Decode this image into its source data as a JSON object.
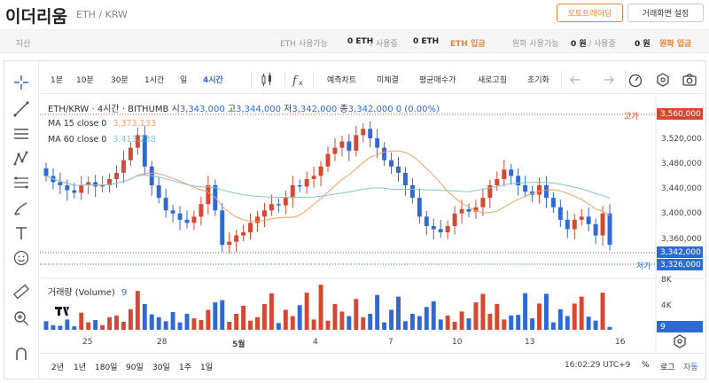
{
  "header": {
    "title": "이더리움",
    "pair": "ETH / KRW",
    "auto_trading_button": "오토트레이딩",
    "settings_button": "거래화면 설정"
  },
  "assets": {
    "label": "자산",
    "eth_available_label": "ETH 사용가능",
    "eth_available_value": "0 ETH",
    "eth_in_use_label": "/ 사용중",
    "eth_in_use_value": "0 ETH",
    "eth_deposit": "ETH 입금",
    "krw_available_label": "원화 사용가능",
    "krw_available_value": "0 원",
    "krw_in_use_label": "/ 사용중",
    "krw_in_use_value": "0 원",
    "krw_deposit": "원화 입금"
  },
  "toolbar": {
    "intervals": [
      "1분",
      "10분",
      "30분",
      "1시간",
      "일",
      "4시간"
    ],
    "active_interval": "4시간",
    "items": [
      "예측차트",
      "미체결",
      "평균매수가",
      "새로고침",
      "초기화"
    ]
  },
  "legend": {
    "symbol": "ETH/KRW · 4시간 · BITHUMB",
    "open_label": "시",
    "open_value": "3,343,000",
    "high_label": "고",
    "high_value": "3,344,000",
    "low_label": "저",
    "low_value": "3,342,000",
    "close_label": "종",
    "close_value": "3,342,000",
    "change": "0 (0.00%)",
    "ma15_label": "MA 15 close 0",
    "ma15_value": "3,373,133",
    "ma60_label": "MA 60 close 0",
    "ma60_value": "3,413,238",
    "volume_label": "거래량 (Volume)",
    "volume_value": "9"
  },
  "colors": {
    "up": "#d64832",
    "down": "#2e6ad6",
    "ma15": "#f0a060",
    "ma60": "#7fc6d6",
    "accent": "#e8833a"
  },
  "chart_data": {
    "type": "candlestick",
    "price_axis": {
      "ticks": [
        "3,520,000",
        "3,480,000",
        "3,440,000",
        "3,400,000",
        "3,360,000"
      ],
      "ylim": [
        3300000,
        3580000
      ]
    },
    "volume_axis": {
      "ticks": [
        "8K",
        "4K"
      ],
      "current": "9"
    },
    "time_labels": [
      "25",
      "28",
      "5월",
      "4",
      "7",
      "10",
      "13",
      "16"
    ],
    "high_label": "고가",
    "high_value": "3,560,000",
    "low_label": "저가",
    "low_value": "3,326,000",
    "current_price": "3,342,000",
    "close": [
      3455000,
      3445000,
      3440000,
      3432000,
      3428000,
      3440000,
      3445000,
      3438000,
      3440000,
      3450000,
      3460000,
      3480000,
      3500000,
      3520000,
      3470000,
      3440000,
      3420000,
      3400000,
      3395000,
      3385000,
      3380000,
      3390000,
      3410000,
      3440000,
      3400000,
      3345000,
      3350000,
      3360000,
      3365000,
      3380000,
      3390000,
      3400000,
      3410000,
      3408000,
      3420000,
      3440000,
      3438000,
      3450000,
      3455000,
      3470000,
      3490000,
      3500000,
      3510000,
      3495000,
      3520000,
      3530000,
      3515000,
      3500000,
      3480000,
      3470000,
      3460000,
      3440000,
      3420000,
      3390000,
      3375000,
      3370000,
      3365000,
      3375000,
      3395000,
      3402000,
      3398000,
      3405000,
      3420000,
      3440000,
      3450000,
      3465000,
      3455000,
      3440000,
      3430000,
      3425000,
      3440000,
      3420000,
      3405000,
      3385000,
      3370000,
      3385000,
      3390000,
      3378000,
      3360000,
      3395000,
      3345000
    ],
    "volume": [
      1500,
      800,
      700,
      1800,
      600,
      3000,
      1300,
      1700,
      800,
      2200,
      2500,
      1400,
      3600,
      6800,
      4500,
      2700,
      2200,
      1500,
      3100,
      1300,
      2800,
      2000,
      1700,
      3500,
      4800,
      5200,
      1400,
      2800,
      4200,
      1600,
      2200,
      4500,
      6400,
      1200,
      3500,
      2400,
      4300,
      6500,
      1800,
      7900,
      1600,
      4500,
      3200,
      2400,
      5400,
      2200,
      2800,
      6100,
      1300,
      3500,
      5800,
      1500,
      2800,
      2400,
      4000,
      5000,
      1800,
      2500,
      1400,
      3200,
      2000,
      4800,
      6300,
      2800,
      4500,
      1800,
      2500,
      2600,
      6400,
      2000,
      4600,
      6300,
      1300,
      3600,
      2400,
      4600,
      5800,
      2300,
      1600,
      6500,
      500
    ]
  },
  "bottom_bar": {
    "ranges": [
      "2년",
      "1년",
      "180일",
      "90일",
      "30일",
      "1주",
      "1일"
    ],
    "time": "16:02:29 UTC+9",
    "percent": "%",
    "log": "로그",
    "auto": "자동"
  }
}
